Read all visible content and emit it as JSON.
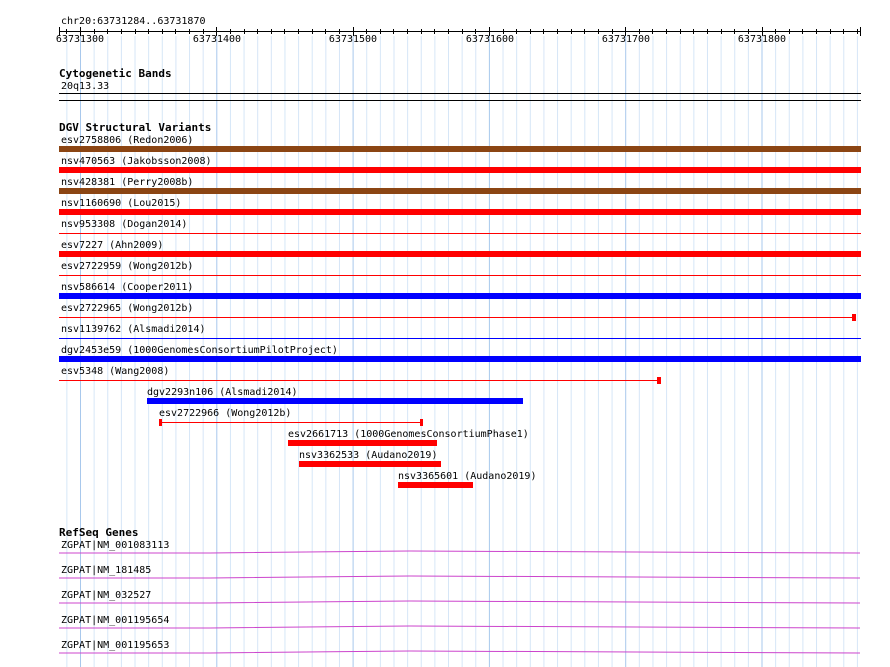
{
  "ruler": {
    "location": "chr20:63731284..63731870",
    "ticks": [
      "63731300",
      "63731400",
      "63731500",
      "63731600",
      "63731700",
      "63731800"
    ]
  },
  "cytobands": {
    "title": "Cytogenetic Bands",
    "band": "20q13.33"
  },
  "dgv": {
    "title": "DGV Structural Variants",
    "features": [
      {
        "label": "esv2758806 (Redon2006)",
        "color": "#8b4513",
        "style": "thick"
      },
      {
        "label": "nsv470563 (Jakobsson2008)",
        "color": "#ff0000",
        "style": "thick"
      },
      {
        "label": "nsv428381 (Perry2008b)",
        "color": "#8b4513",
        "style": "thick"
      },
      {
        "label": "nsv1160690 (Lou2015)",
        "color": "#ff0000",
        "style": "thick"
      },
      {
        "label": "nsv953308 (Dogan2014)",
        "color": "#ff0000",
        "style": "thin"
      },
      {
        "label": "esv7227 (Ahn2009)",
        "color": "#ff0000",
        "style": "thick"
      },
      {
        "label": "esv2722959 (Wong2012b)",
        "color": "#ff0000",
        "style": "thin"
      },
      {
        "label": "nsv586614 (Cooper2011)",
        "color": "#0000ff",
        "style": "thick"
      },
      {
        "label": "esv2722965 (Wong2012b)",
        "color": "#ff0000",
        "style": "thin-end"
      },
      {
        "label": "nsv1139762 (Alsmadi2014)",
        "color": "#0000ff",
        "style": "thin"
      },
      {
        "label": "dgv2453e59 (1000GenomesConsortiumPilotProject)",
        "color": "#0000ff",
        "style": "thick"
      },
      {
        "label": "esv5348 (Wang2008)",
        "color": "#ff0000",
        "style": "thin-end"
      },
      {
        "label": "dgv2293n106 (Alsmadi2014)",
        "color": "#0000ff",
        "style": "thick"
      },
      {
        "label": "esv2722966 (Wong2012b)",
        "color": "#ff0000",
        "style": "thin-both"
      },
      {
        "label": "esv2661713 (1000GenomesConsortiumPhase1)",
        "color": "#ff0000",
        "style": "thick"
      },
      {
        "label": "nsv3362533 (Audano2019)",
        "color": "#ff0000",
        "style": "thick"
      },
      {
        "label": "nsv3365601 (Audano2019)",
        "color": "#ff0000",
        "style": "thick"
      }
    ]
  },
  "refseq": {
    "title": "RefSeq Genes",
    "color": "#cc44cc",
    "genes": [
      "ZGPAT|NM_001083113",
      "ZGPAT|NM_181485",
      "ZGPAT|NM_032527",
      "ZGPAT|NM_001195654",
      "ZGPAT|NM_001195653"
    ]
  }
}
